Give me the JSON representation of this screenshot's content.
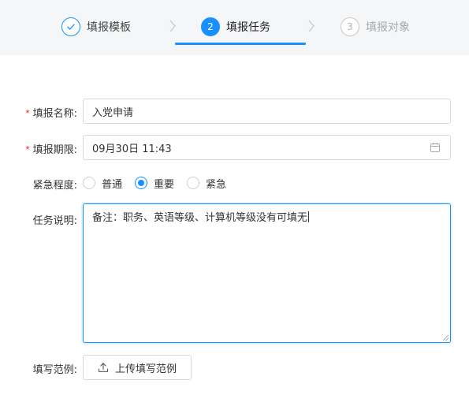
{
  "steps": [
    {
      "index": "1",
      "label": "填报模板",
      "state": "done"
    },
    {
      "index": "2",
      "label": "填报任务",
      "state": "active"
    },
    {
      "index": "3",
      "label": "填报对象",
      "state": "wait"
    }
  ],
  "form": {
    "name": {
      "label": "填报名称",
      "colon": ":",
      "required": "*",
      "value": "入党申请"
    },
    "deadline": {
      "label": "填报期限",
      "colon": ":",
      "required": "*",
      "value": "09月30日 11:43",
      "icon": "calendar-icon"
    },
    "urgency": {
      "label": "紧急程度",
      "colon": ":",
      "options": [
        "普通",
        "重要",
        "紧急"
      ],
      "selected": "重要"
    },
    "description": {
      "label": "任务说明",
      "colon": ":",
      "value": "备注：职务、英语等级、计算机等级没有可填无"
    },
    "sample": {
      "label": "填写范例",
      "colon": ":",
      "button_label": "上传填写范例",
      "icon": "upload-icon"
    }
  },
  "colors": {
    "accent": "#1890ff",
    "required": "#f5222d",
    "border": "#d9d9d9",
    "header_bg": "#f5f6f8"
  }
}
